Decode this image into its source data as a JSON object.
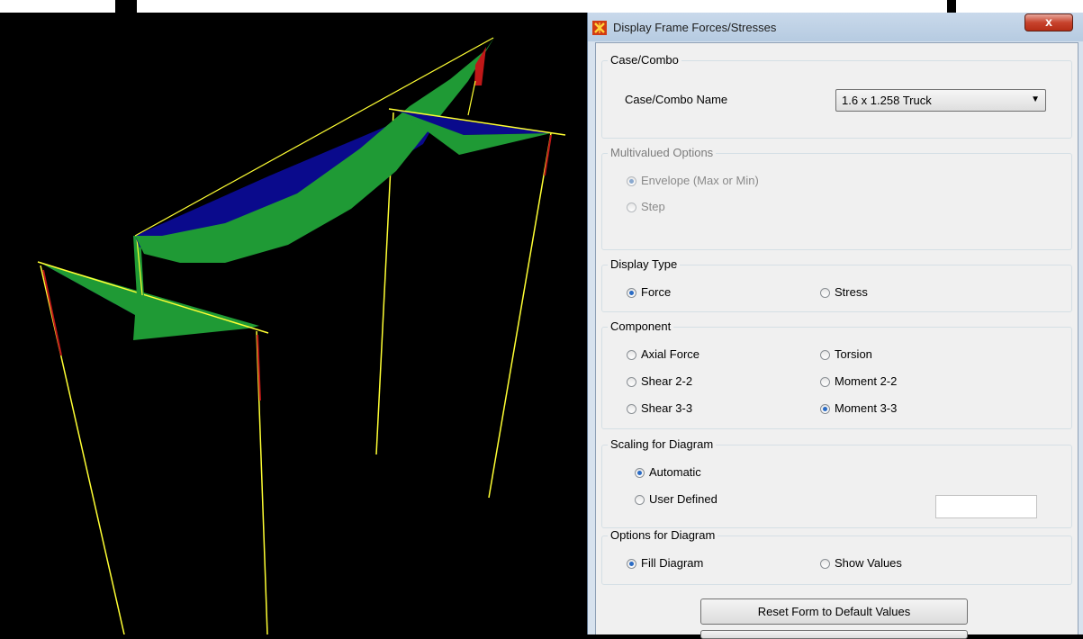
{
  "window": {
    "title": "Display Frame Forces/Stresses",
    "close_glyph": "x"
  },
  "case_combo": {
    "group_label": "Case/Combo",
    "field_label": "Case/Combo Name",
    "selected_value": "1.6 x 1.258 Truck",
    "dropdown_icon": "chevron-down-icon"
  },
  "multivalued": {
    "group_label": "Multivalued Options",
    "options": [
      {
        "label": "Envelope (Max or Min)",
        "selected": true,
        "enabled": false
      },
      {
        "label": "Step",
        "selected": false,
        "enabled": false
      }
    ]
  },
  "display_type": {
    "group_label": "Display Type",
    "options": [
      {
        "label": "Force",
        "selected": true
      },
      {
        "label": "Stress",
        "selected": false
      }
    ]
  },
  "component": {
    "group_label": "Component",
    "options": [
      {
        "label": "Axial Force",
        "selected": false
      },
      {
        "label": "Torsion",
        "selected": false
      },
      {
        "label": "Shear 2-2",
        "selected": false
      },
      {
        "label": "Moment 2-2",
        "selected": false
      },
      {
        "label": "Shear 3-3",
        "selected": false
      },
      {
        "label": "Moment 3-3",
        "selected": true
      }
    ]
  },
  "scaling": {
    "group_label": "Scaling for Diagram",
    "options": [
      {
        "label": "Automatic",
        "selected": true
      },
      {
        "label": "User Defined",
        "selected": false
      }
    ],
    "scale_value": ""
  },
  "options_diagram": {
    "group_label": "Options for Diagram",
    "options": [
      {
        "label": "Fill Diagram",
        "selected": true
      },
      {
        "label": "Show Values",
        "selected": false
      }
    ]
  },
  "buttons": {
    "reset_label": "Reset Form to Default Values"
  },
  "colors": {
    "viewport_background": "#000000",
    "positive_fill": "#1f9a35",
    "negative_fill": "#0a0a8c",
    "frame_line": "#ffff33",
    "extreme_marker": "#c01818"
  }
}
